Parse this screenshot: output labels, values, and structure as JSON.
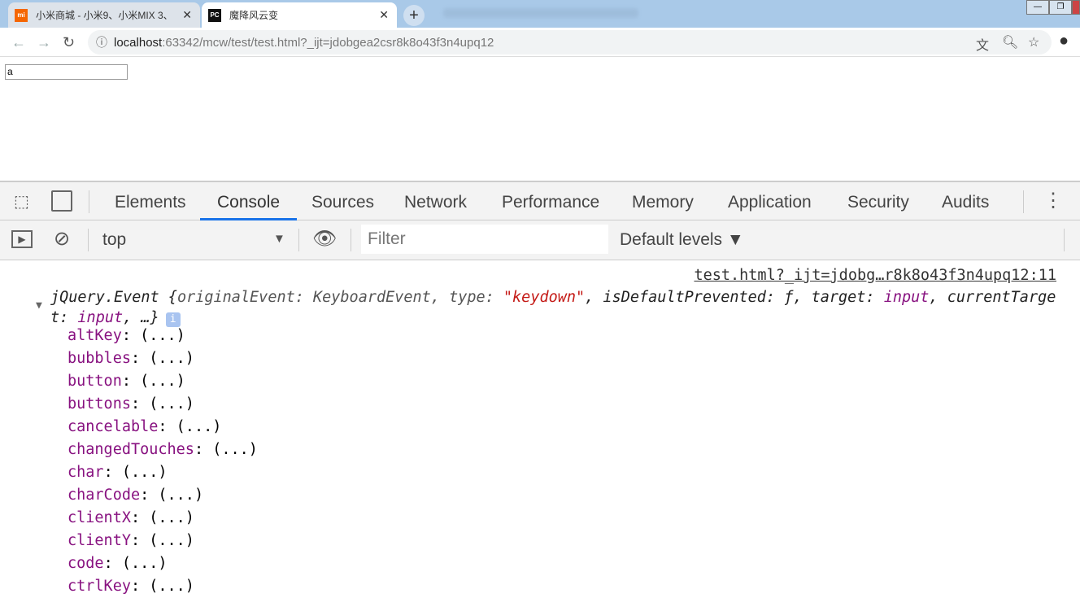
{
  "browser": {
    "tabs": [
      {
        "title": "小米商城 - 小米9、小米MIX 3、",
        "favicon": "mi-icon"
      },
      {
        "title": "魔降风云变",
        "favicon": "pycharm-icon",
        "active": true
      }
    ],
    "url_host": "localhost",
    "url_rest": ":63342/mcw/test/test.html?_ijt=jdobgea2csr8k8o43f3n4upq12"
  },
  "page": {
    "input_value": "a"
  },
  "devtools": {
    "tabs": [
      "Elements",
      "Console",
      "Sources",
      "Network",
      "Performance",
      "Memory",
      "Application",
      "Security",
      "Audits"
    ],
    "active_tab": "Console",
    "context": "top",
    "filter_placeholder": "Filter",
    "levels": "Default levels ▼"
  },
  "console": {
    "source_link": "test.html?_ijt=jdobg…r8k8o43f3n4upq12:11",
    "summary": {
      "p1": "jQuery.Event {",
      "p2": "originalEvent: KeyboardEvent, type: ",
      "p3": "\"keydown\"",
      "p4": ", isDefaultPrevented: ƒ, target: ",
      "p5": "input",
      "p6": ", currentTarget: ",
      "p7": "input",
      "p8": ", …}"
    },
    "properties": [
      "altKey",
      "bubbles",
      "button",
      "buttons",
      "cancelable",
      "changedTouches",
      "char",
      "charCode",
      "clientX",
      "clientY",
      "code",
      "ctrlKey"
    ],
    "lazy_value": "(...)"
  }
}
